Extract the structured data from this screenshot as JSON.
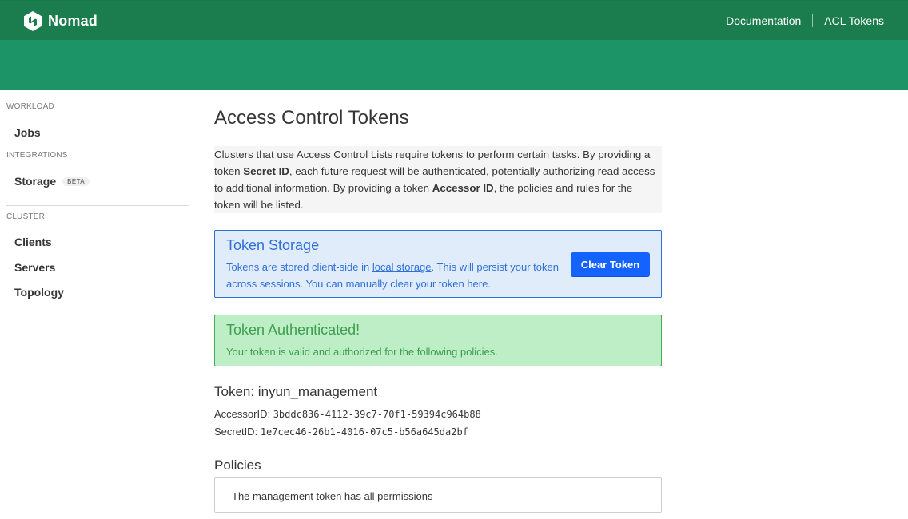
{
  "header": {
    "app_name": "Nomad",
    "nav": [
      "Documentation",
      "ACL Tokens"
    ],
    "colors": {
      "topbar": "#1b7d4e",
      "subbar": "#1d9467"
    }
  },
  "sidebar": {
    "sections": [
      {
        "label": "WORKLOAD",
        "items": [
          {
            "label": "Jobs"
          }
        ]
      },
      {
        "label": "INTEGRATIONS",
        "items": [
          {
            "label": "Storage",
            "badge": "BETA"
          }
        ]
      },
      {
        "label": "CLUSTER",
        "items": [
          {
            "label": "Clients"
          },
          {
            "label": "Servers"
          },
          {
            "label": "Topology"
          }
        ]
      }
    ]
  },
  "main": {
    "title": "Access Control Tokens",
    "intro": {
      "p1": "Clusters that use Access Control Lists require tokens to perform certain tasks. By providing a token ",
      "b1": "Secret ID",
      "p2": ", each future request will be authenticated, potentially authorizing read access to additional information. By providing a token ",
      "b2": "Accessor ID",
      "p3": ", the policies and rules for the token will be listed."
    },
    "storage": {
      "title": "Token Storage",
      "body_pre": "Tokens are stored client-side in ",
      "link": "local storage",
      "body_post": ". This will persist your token across sessions. You can manually clear your token here.",
      "button": "Clear Token",
      "color": "#2f6fd8"
    },
    "auth": {
      "title": "Token Authenticated!",
      "body": "Your token is valid and authorized for the following policies.",
      "color": "#3f9e51"
    },
    "token": {
      "heading": "Token: inyun_management",
      "accessor_label": "AccessorID:",
      "accessor_value": "3bddc836-4112-39c7-70f1-59394c964b88",
      "secret_label": "SecretID:",
      "secret_value": "1e7cec46-26b1-4016-07c5-b56a645da2bf"
    },
    "policies": {
      "heading": "Policies",
      "items": [
        "The management token has all permissions"
      ]
    }
  }
}
